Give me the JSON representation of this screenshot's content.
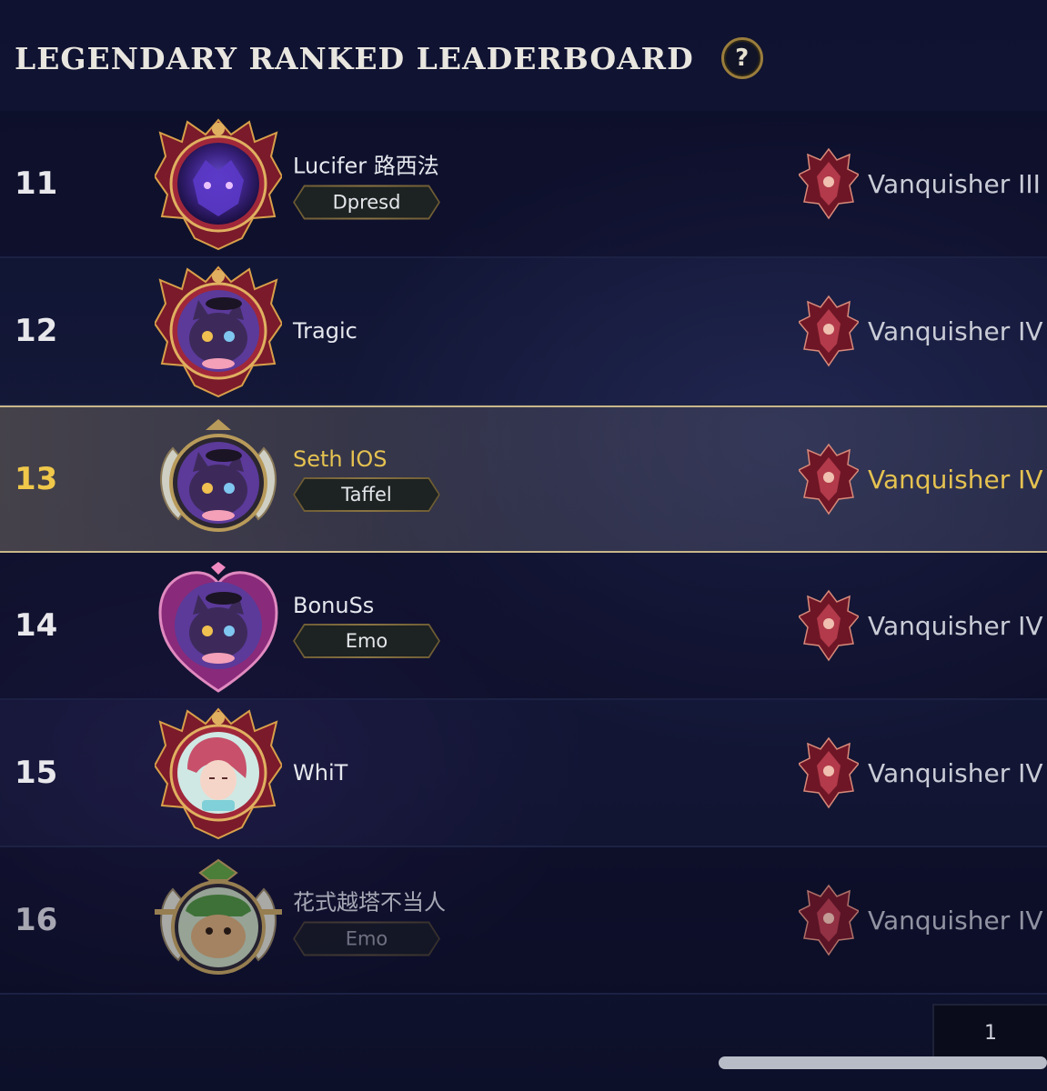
{
  "header": {
    "title": "LEGENDARY RANKED LEADERBOARD",
    "help_icon": "question-mark-icon",
    "help_glyph": "?"
  },
  "rows": [
    {
      "rank": "11",
      "name": "Lucifer 路西法",
      "tag": "Dpresd",
      "tier": "Vanquisher III",
      "avatar": "purple-wolf-avatar",
      "frame": "spiked-ruby-frame"
    },
    {
      "rank": "12",
      "name": "Tragic",
      "tag": "",
      "tier": "Vanquisher IV",
      "avatar": "cat-with-hat-avatar",
      "frame": "spiked-ruby-frame"
    },
    {
      "rank": "13",
      "name": "Seth IOS",
      "tag": "Taffel",
      "tier": "Vanquisher IV",
      "avatar": "cat-with-hat-avatar",
      "frame": "horned-silver-frame",
      "highlighted": true
    },
    {
      "rank": "14",
      "name": "BonuSs",
      "tag": "Emo",
      "tier": "Vanquisher IV",
      "avatar": "cat-with-hat-avatar",
      "frame": "heart-frame"
    },
    {
      "rank": "15",
      "name": "WhiT",
      "tag": "",
      "tier": "Vanquisher IV",
      "avatar": "pink-hair-girl-avatar",
      "frame": "spiked-ruby-frame"
    },
    {
      "rank": "16",
      "name": "花式越塔不当人",
      "tag": "Emo",
      "tier": "Vanquisher IV",
      "avatar": "teemo-avatar",
      "frame": "horned-silver-frame"
    }
  ],
  "tier_icon": "vanquisher-emblem-icon",
  "pagination": {
    "current_page": "1"
  },
  "colors": {
    "highlight_text": "#e5c250",
    "highlight_border": "#c8b78a",
    "background": "#131735"
  }
}
